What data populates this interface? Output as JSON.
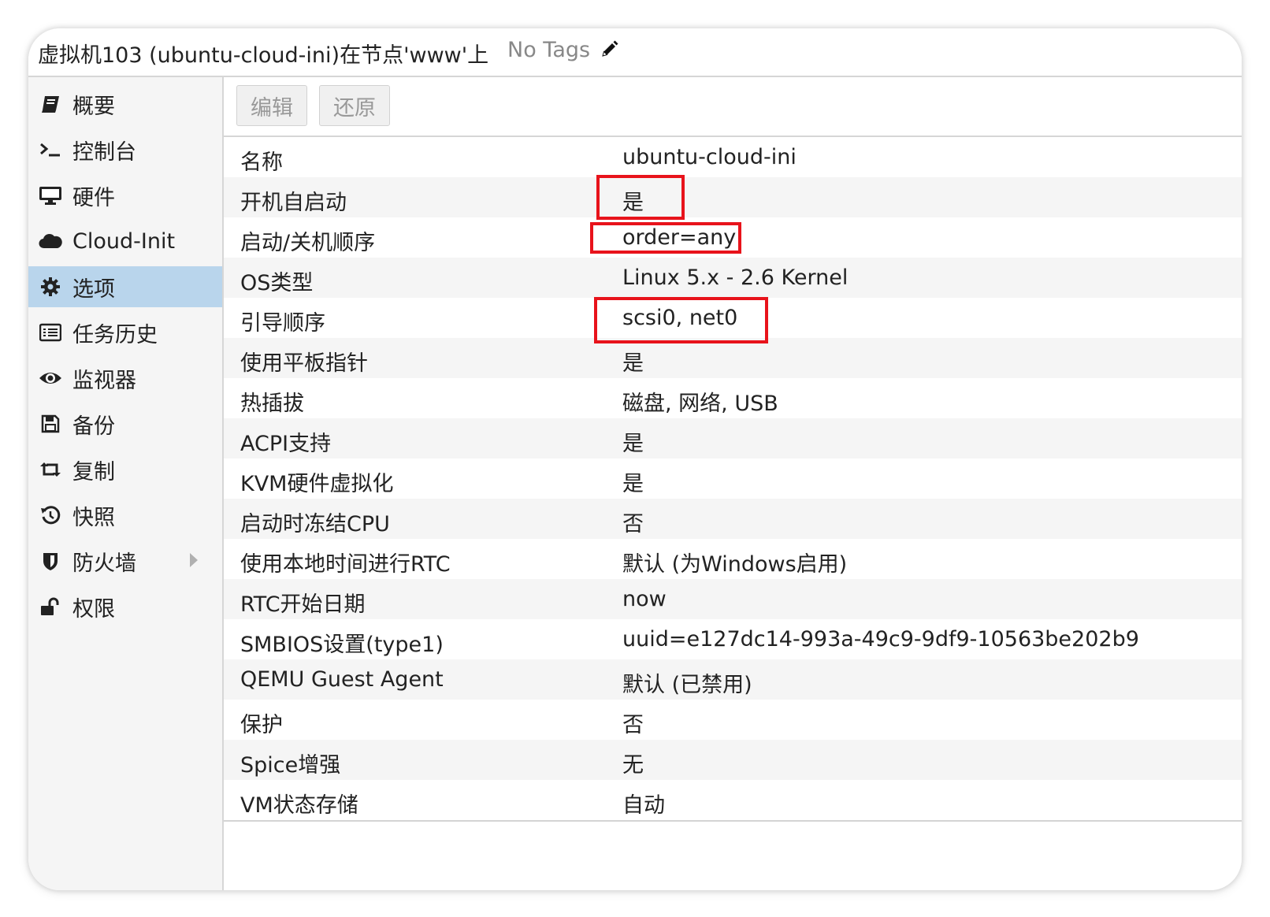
{
  "header": {
    "title": "虚拟机103 (ubuntu-cloud-ini)在节点'www'上",
    "tags_label": "No Tags"
  },
  "sidebar": {
    "items": [
      {
        "label": "概要",
        "icon": "book-icon"
      },
      {
        "label": "控制台",
        "icon": "terminal-icon"
      },
      {
        "label": "硬件",
        "icon": "monitor-icon"
      },
      {
        "label": "Cloud-Init",
        "icon": "cloud-icon"
      },
      {
        "label": "选项",
        "icon": "gear-icon",
        "active": true
      },
      {
        "label": "任务历史",
        "icon": "list-icon"
      },
      {
        "label": "监视器",
        "icon": "eye-icon"
      },
      {
        "label": "备份",
        "icon": "floppy-icon"
      },
      {
        "label": "复制",
        "icon": "retweet-icon"
      },
      {
        "label": "快照",
        "icon": "history-icon"
      },
      {
        "label": "防火墙",
        "icon": "shield-icon",
        "has_submenu": true
      },
      {
        "label": "权限",
        "icon": "unlock-icon"
      }
    ]
  },
  "toolbar": {
    "edit_label": "编辑",
    "revert_label": "还原"
  },
  "options": {
    "rows": [
      {
        "key": "名称",
        "value": "ubuntu-cloud-ini"
      },
      {
        "key": "开机自启动",
        "value": "是",
        "highlighted": true
      },
      {
        "key": "启动/关机顺序",
        "value": "order=any",
        "highlighted": true
      },
      {
        "key": "OS类型",
        "value": "Linux 5.x - 2.6 Kernel"
      },
      {
        "key": "引导顺序",
        "value": "scsi0, net0",
        "highlighted": true
      },
      {
        "key": "使用平板指针",
        "value": "是"
      },
      {
        "key": "热插拔",
        "value": "磁盘, 网络, USB"
      },
      {
        "key": "ACPI支持",
        "value": "是"
      },
      {
        "key": "KVM硬件虚拟化",
        "value": "是"
      },
      {
        "key": "启动时冻结CPU",
        "value": "否"
      },
      {
        "key": "使用本地时间进行RTC",
        "value": "默认 (为Windows启用)"
      },
      {
        "key": "RTC开始日期",
        "value": "now"
      },
      {
        "key": "SMBIOS设置(type1)",
        "value": "uuid=e127dc14-993a-49c9-9df9-10563be202b9"
      },
      {
        "key": "QEMU Guest Agent",
        "value": "默认 (已禁用)"
      },
      {
        "key": "保护",
        "value": "否"
      },
      {
        "key": "Spice增强",
        "value": "无"
      },
      {
        "key": "VM状态存储",
        "value": "自动"
      }
    ]
  },
  "colors": {
    "accent_selected": "#b9d5ec",
    "highlight_box": "#e8131b"
  }
}
